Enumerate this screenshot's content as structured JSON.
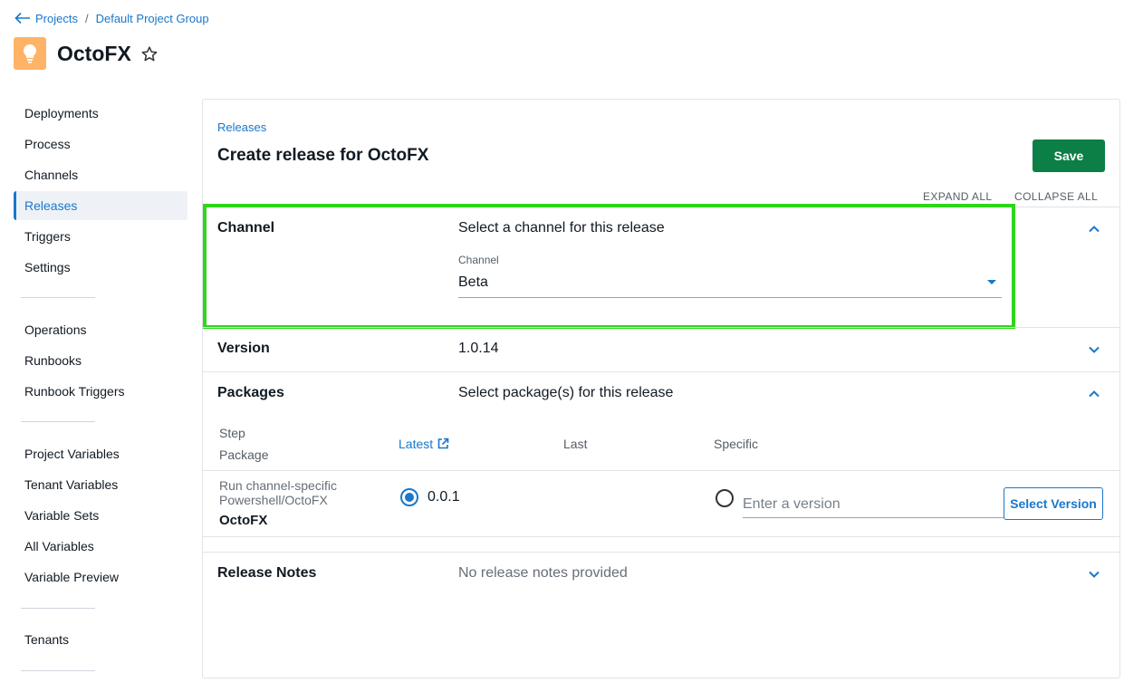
{
  "breadcrumb": {
    "projects": "Projects",
    "separator": "/",
    "group": "Default Project Group"
  },
  "project": {
    "name": "OctoFX",
    "logo_color": "#ffb366",
    "logo_icon": "lightbulb-icon"
  },
  "sidebar": {
    "group1": [
      "Deployments",
      "Process",
      "Channels",
      "Releases",
      "Triggers",
      "Settings"
    ],
    "group2": [
      "Operations",
      "Runbooks",
      "Runbook Triggers"
    ],
    "group3": [
      "Project Variables",
      "Tenant Variables",
      "Variable Sets",
      "All Variables",
      "Variable Preview"
    ],
    "group4": [
      "Tenants"
    ],
    "active": "Releases"
  },
  "main": {
    "crumb": "Releases",
    "title": "Create release for OctoFX",
    "save_label": "Save",
    "expand_all": "EXPAND ALL",
    "collapse_all": "COLLAPSE ALL",
    "channel": {
      "label": "Channel",
      "summary": "Select a channel for this release",
      "field_label": "Channel",
      "value": "Beta"
    },
    "version": {
      "label": "Version",
      "value": "1.0.14"
    },
    "packages": {
      "label": "Packages",
      "summary": "Select package(s) for this release",
      "col_step": "Step",
      "col_package": "Package",
      "col_latest": "Latest",
      "col_last": "Last",
      "col_specific": "Specific",
      "row": {
        "step": "Run channel-specific Powershell/OctoFX",
        "package": "OctoFX",
        "latest_version": "0.0.1",
        "specific_placeholder": "Enter a version",
        "select_version": "Select Version"
      }
    },
    "release_notes": {
      "label": "Release Notes",
      "summary": "No release notes provided"
    }
  },
  "colors": {
    "accent": "#1a77ca",
    "save": "#0b7f45",
    "highlight": "#2fd61c"
  }
}
